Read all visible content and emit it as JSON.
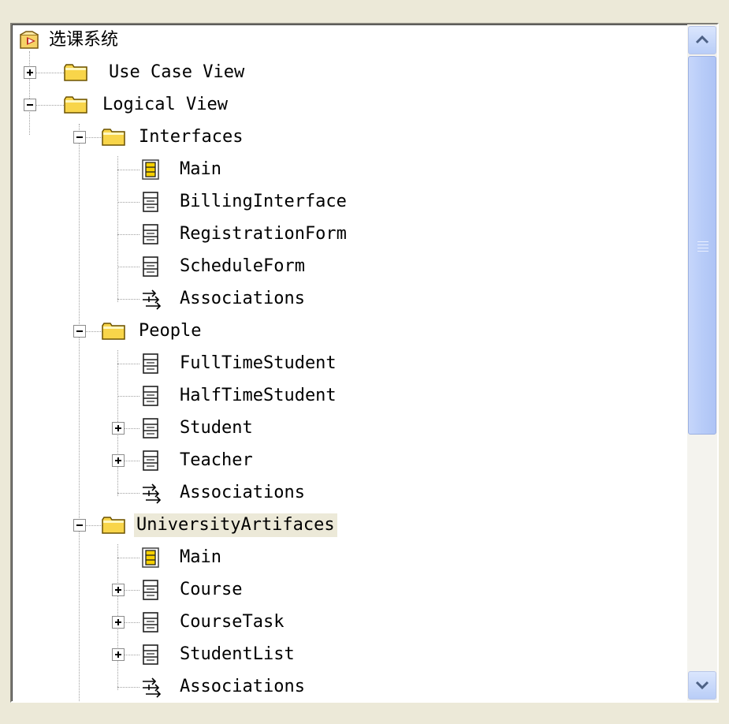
{
  "tree": {
    "root": {
      "label": "选课系统",
      "icon": "model-icon"
    },
    "nodes": [
      {
        "label": "Use Case View",
        "icon": "folder-icon",
        "expander": "plus"
      },
      {
        "label": "Logical View",
        "icon": "folder-icon",
        "expander": "minus"
      },
      {
        "label": "Interfaces",
        "icon": "folder-icon",
        "expander": "minus"
      },
      {
        "label": "Main",
        "icon": "class-diagram-icon"
      },
      {
        "label": "BillingInterface",
        "icon": "class-icon"
      },
      {
        "label": "RegistrationForm",
        "icon": "class-icon"
      },
      {
        "label": "ScheduleForm",
        "icon": "class-icon"
      },
      {
        "label": "Associations",
        "icon": "associations-icon"
      },
      {
        "label": "People",
        "icon": "folder-icon",
        "expander": "minus"
      },
      {
        "label": "FullTimeStudent",
        "icon": "class-icon"
      },
      {
        "label": "HalfTimeStudent",
        "icon": "class-icon"
      },
      {
        "label": "Student",
        "icon": "class-icon",
        "expander": "plus"
      },
      {
        "label": "Teacher",
        "icon": "class-icon",
        "expander": "plus"
      },
      {
        "label": "Associations",
        "icon": "associations-icon"
      },
      {
        "label": "UniversityArtifaces",
        "icon": "folder-icon",
        "expander": "minus",
        "selected": true
      },
      {
        "label": "Main",
        "icon": "class-diagram-icon"
      },
      {
        "label": "Course",
        "icon": "class-icon",
        "expander": "plus"
      },
      {
        "label": "CourseTask",
        "icon": "class-icon",
        "expander": "plus"
      },
      {
        "label": "StudentList",
        "icon": "class-icon",
        "expander": "plus"
      },
      {
        "label": "Associations",
        "icon": "associations-icon"
      }
    ]
  },
  "scrollbar": {
    "up_icon": "chevron-up-icon",
    "down_icon": "chevron-down-icon",
    "thumb_icon": "grip-icon"
  }
}
